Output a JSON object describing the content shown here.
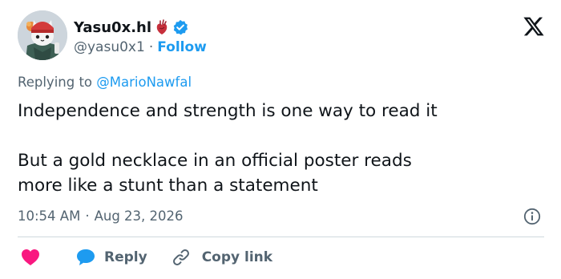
{
  "author": {
    "display_name": "Yasu0x.hl",
    "handle": "@yasu0x1",
    "follow_label": "Follow",
    "separator": "·",
    "badge_emoji": "anatomical-heart-icon",
    "verified_icon": "verified-badge-icon",
    "avatar": "cartoon-cat-avatar"
  },
  "platform_logo": "x-logo-icon",
  "replying": {
    "prefix": "Replying to",
    "mention": "@MarioNawfal"
  },
  "tweet": {
    "lines": [
      "Independence and strength is one way to read it",
      "But a gold necklace in an official poster reads",
      "more like a stunt than a statement"
    ]
  },
  "meta": {
    "time": "10:54 AM",
    "separator": "·",
    "date": "Aug 23, 2026",
    "info_icon": "info-icon"
  },
  "actions": {
    "like_icon": "heart-icon",
    "reply_label": "Reply",
    "reply_icon": "speech-bubble-icon",
    "copy_label": "Copy link",
    "copy_icon": "link-icon"
  },
  "colors": {
    "accent": "#1d9bf0",
    "text": "#0f1419",
    "secondary": "#536471",
    "like": "#f91880",
    "divider": "#cfd9de"
  }
}
